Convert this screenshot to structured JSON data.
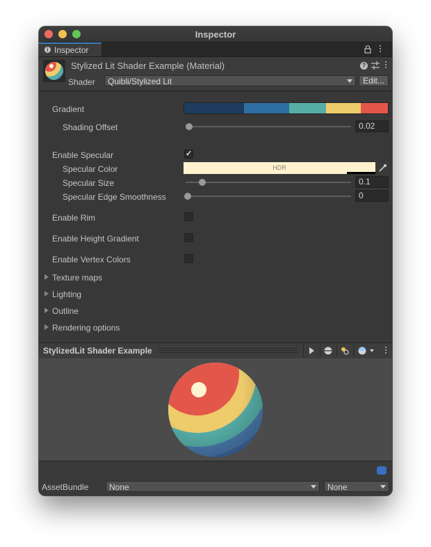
{
  "window": {
    "title": "Inspector"
  },
  "tab": {
    "label": "Inspector"
  },
  "header": {
    "material_name": "Stylized Lit Shader Example (Material)",
    "shader_label": "Shader",
    "shader_value": "Quibli/Stylized Lit",
    "edit_label": "Edit..."
  },
  "properties": {
    "gradient_label": "Gradient",
    "gradient_colors": [
      "#1e3d5e",
      "#2e6ea1",
      "#55ada6",
      "#eecb6b",
      "#e3574a"
    ],
    "shading_offset_label": "Shading Offset",
    "shading_offset_value": "0.02",
    "shading_offset_fraction": 0.02,
    "enable_specular_label": "Enable Specular",
    "enable_specular_checked": true,
    "specular_color_label": "Specular Color",
    "specular_color_value": "#fff2cf",
    "specular_color_tag": "HDR",
    "specular_size_label": "Specular Size",
    "specular_size_value": "0.1",
    "specular_size_fraction": 0.1,
    "specular_edge_label": "Specular Edge Smoothness",
    "specular_edge_value": "0",
    "enable_rim_label": "Enable Rim",
    "enable_height_gradient_label": "Enable Height Gradient",
    "enable_vertex_colors_label": "Enable Vertex Colors"
  },
  "foldouts": [
    "Texture maps",
    "Lighting",
    "Outline",
    "Rendering options"
  ],
  "preview": {
    "title": "StylizedLit Shader Example"
  },
  "footer": {
    "assetbundle_label": "AssetBundle",
    "bundle_value": "None",
    "variant_value": "None"
  },
  "icons": {
    "info": "info-icon",
    "lock": "lock-icon",
    "menu": "kebab-menu-icon",
    "help": "help-icon",
    "presets": "sliders-icon",
    "play": "play-icon",
    "sphere": "sphere-icon",
    "lights": "lights-icon",
    "label": "label-icon"
  }
}
